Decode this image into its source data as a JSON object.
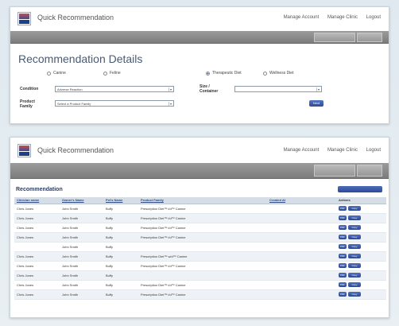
{
  "colors": {
    "nav_bar": "#8a8a8a",
    "accent": "#2c4b98",
    "title": "#4a5a70",
    "link": "#2e4b88"
  },
  "app": {
    "title": "Quick Recommendation",
    "nav": [
      "Manage Account",
      "Manage Clinic",
      "Logout"
    ],
    "logo_icon": "brand-logo-icon"
  },
  "top_panel": {
    "toolbar": {
      "btn1": "",
      "btn2": ""
    },
    "heading": "Recommendation Details",
    "radios": {
      "canine": "Canine",
      "feline": "Feline",
      "therapeutic": "Therapeutic Diet",
      "wellness": "Wellness Diet"
    },
    "condition": {
      "label": "Condition",
      "value": "Adverse Reaction",
      "caret": "▾"
    },
    "product_family": {
      "label": "Product Family",
      "value": "Select a Product Family",
      "caret": "▾"
    },
    "size": {
      "label": "Size / Container",
      "value": "",
      "caret": "▾"
    },
    "next_label": "Next"
  },
  "bottom_panel": {
    "toolbar": {
      "btn1": "",
      "btn2": ""
    },
    "heading": "Recommendation",
    "show_button": "",
    "columns": [
      "Clinician name",
      "Owner's Name",
      "Pet's Name",
      "Product Family",
      "Created At",
      "Actions"
    ],
    "action_labels": {
      "pdf": "PDF",
      "copy": "Copy"
    },
    "rows": [
      {
        "clinician": "Chris Jones",
        "owner": "John Smith",
        "pet": "Buffy",
        "product": "Prescription Diet™ i/d™ Canine",
        "created": ""
      },
      {
        "clinician": "Chris Jones",
        "owner": "John Smith",
        "pet": "Buffy",
        "product": "Prescription Diet™ i/d™ Canine",
        "created": ""
      },
      {
        "clinician": "Chris Jones",
        "owner": "John Smith",
        "pet": "Buffy",
        "product": "Prescription Diet™ i/d™ Canine",
        "created": ""
      },
      {
        "clinician": "Chris Jones",
        "owner": "John Smith",
        "pet": "Buffy",
        "product": "Prescription Diet™ i/d™ Canine",
        "created": ""
      },
      {
        "clinician": "",
        "owner": "John Smith",
        "pet": "Buffy",
        "product": "",
        "created": ""
      },
      {
        "clinician": "Chris Jones",
        "owner": "John Smith",
        "pet": "Buffy",
        "product": "Prescription Diet™ w/d™ Canine",
        "created": ""
      },
      {
        "clinician": "Chris Jones",
        "owner": "John Smith",
        "pet": "Buffy",
        "product": "Prescription Diet™ i/d™ Canine",
        "created": ""
      },
      {
        "clinician": "Chris Jones",
        "owner": "John Smith",
        "pet": "Buffy",
        "product": "",
        "created": ""
      },
      {
        "clinician": "Chris Jones",
        "owner": "John Smith",
        "pet": "Buffy",
        "product": "Prescription Diet™ i/d™ Canine",
        "created": ""
      },
      {
        "clinician": "Chris Jones",
        "owner": "John Smith",
        "pet": "Buffy",
        "product": "Prescription Diet™ i/d™ Canine",
        "created": ""
      }
    ]
  }
}
